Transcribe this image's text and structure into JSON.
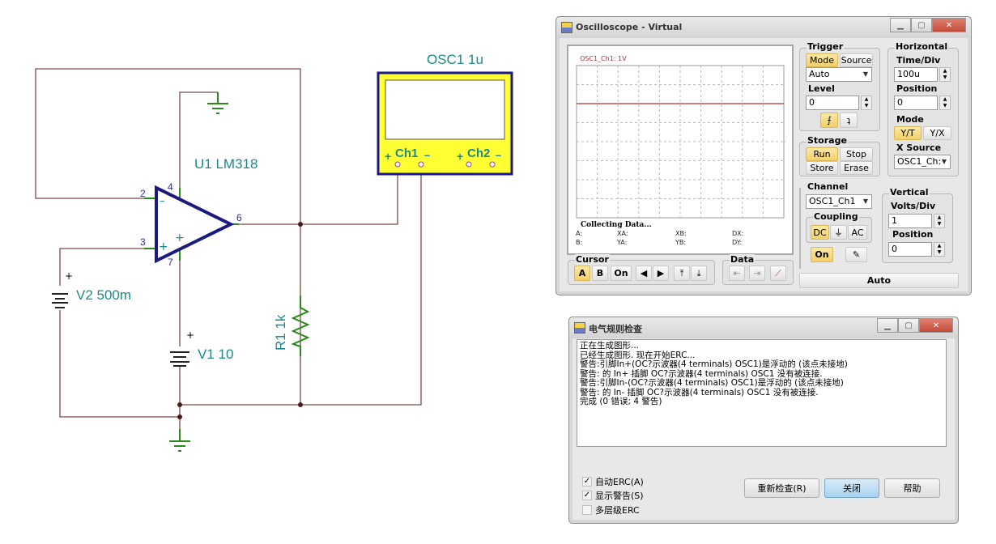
{
  "schematic": {
    "oscilloscope_label": "OSC1 1u",
    "ch1_label": "Ch1",
    "ch2_label": "Ch2",
    "plus": "+",
    "minus": "–",
    "opamp_label": "U1 LM318",
    "pin2": "2",
    "pin3": "3",
    "pin4": "4",
    "pin6": "6",
    "pin7": "7",
    "v2_label": "V2 500m",
    "v1_label": "V1 10",
    "r1_label": "R1 1k",
    "colors": {
      "wire": "#7a4a44",
      "component": "#1a1a80",
      "label": "#1a8a8a",
      "resistor": "#2a8a1a",
      "scope_body": "#ffff33"
    }
  },
  "scope": {
    "title": "Oscilloscope - Virtual",
    "channel_caption": "OSC1_Ch1: 1V",
    "status": "Collecting Data...",
    "readouts": [
      "A:",
      "XA:",
      "XB:",
      "DX:",
      "B:",
      "YA:",
      "YB:",
      "DY:"
    ],
    "trace_color": "#b03030",
    "trace_level_div": 2,
    "trigger": {
      "label": "Trigger",
      "mode": "Mode",
      "source": "Source",
      "mode_value": "Auto",
      "level_label": "Level",
      "level_value": "0",
      "rising_icon": "rising-edge-icon",
      "falling_icon": "falling-edge-icon"
    },
    "horizontal": {
      "label": "Horizontal",
      "time_div_label": "Time/Div",
      "time_div": "100u",
      "position_label": "Position",
      "position": "0",
      "mode_label": "Mode",
      "yt": "Y/T",
      "yx": "Y/X",
      "xsource_label": "X Source",
      "xsource": "OSC1_Ch:"
    },
    "storage": {
      "label": "Storage",
      "run": "Run",
      "stop": "Stop",
      "store": "Store",
      "erase": "Erase"
    },
    "channel": {
      "label": "Channel",
      "value": "OSC1_Ch1",
      "coupling_label": "Coupling",
      "dc": "DC",
      "gnd": "⏚",
      "ac": "AC",
      "on": "On"
    },
    "vertical": {
      "label": "Vertical",
      "volts_div_label": "Volts/Div",
      "volts_div": "1",
      "position_label": "Position",
      "position": "0"
    },
    "cursor": {
      "label": "Cursor",
      "a": "A",
      "b": "B",
      "on": "On"
    },
    "data": {
      "label": "Data"
    },
    "auto": "Auto"
  },
  "erc": {
    "title": "电气规则检查",
    "log": "正在生成图形...\n已经生成图形. 现在开始ERC...\n警告:引脚In+(OC?示波器(4 terminals) OSC1)是浮动的 (该点未接地)\n警告: 的 In+ 插脚 OC?示波器(4 terminals) OSC1 没有被连接.\n警告:引脚In-(OC?示波器(4 terminals) OSC1)是浮动的 (该点未接地)\n警告: 的 In- 插脚 OC?示波器(4 terminals) OSC1 没有被连接.\n完成 (0 错误; 4 警告)",
    "auto_erc": "自动ERC(A)",
    "auto_erc_checked": true,
    "show_warnings": "显示警告(S)",
    "show_warnings_checked": true,
    "multilevel": "多层级ERC",
    "multilevel_checked": false,
    "recheck": "重新检查(R)",
    "close": "关闭",
    "help": "帮助"
  }
}
